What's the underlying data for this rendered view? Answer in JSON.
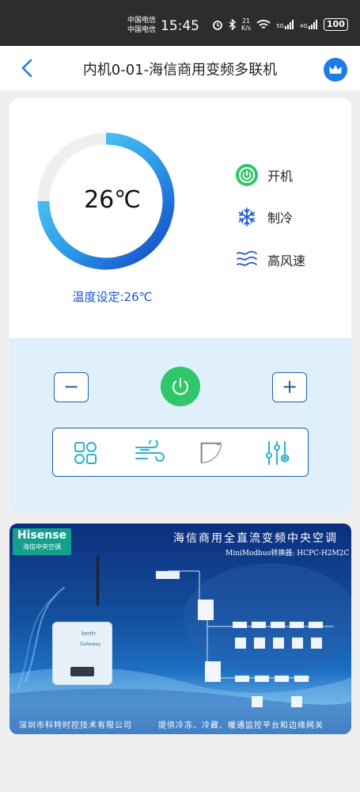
{
  "status_bar": {
    "carrier1": "中国电信",
    "carrier2": "中国电信",
    "time": "15:45",
    "net_speed_top": "21",
    "net_speed_bottom": "K/s",
    "signal1": "5G",
    "signal2": "4G",
    "battery": "100"
  },
  "nav": {
    "title": "内机0-01-海信商用变频多联机"
  },
  "thermostat": {
    "temperature": "26℃",
    "setpoint": "温度设定:26℃",
    "gauge_fill_fraction": 0.75
  },
  "status": {
    "power": "开机",
    "mode": "制冷",
    "fan": "高风速"
  },
  "controls": {
    "minus": "−",
    "plus": "+"
  },
  "banner": {
    "brand_name": "Hisense",
    "brand_sub": "海信中央空调",
    "title": "海信商用全直流变频中央空调",
    "subtitle": "MiniModbus转换器: HCPC-H2M2C",
    "footer_left": "深圳市科特时控技术有限公司",
    "footer_right": "提供冷冻、冷藏、暖通监控平台和边缘网关",
    "device_brand": "kentr",
    "device_label": "Gateway"
  },
  "colors": {
    "accent": "#1a56c9",
    "power_green": "#2fc769",
    "panel_blue": "#dff0fb"
  }
}
